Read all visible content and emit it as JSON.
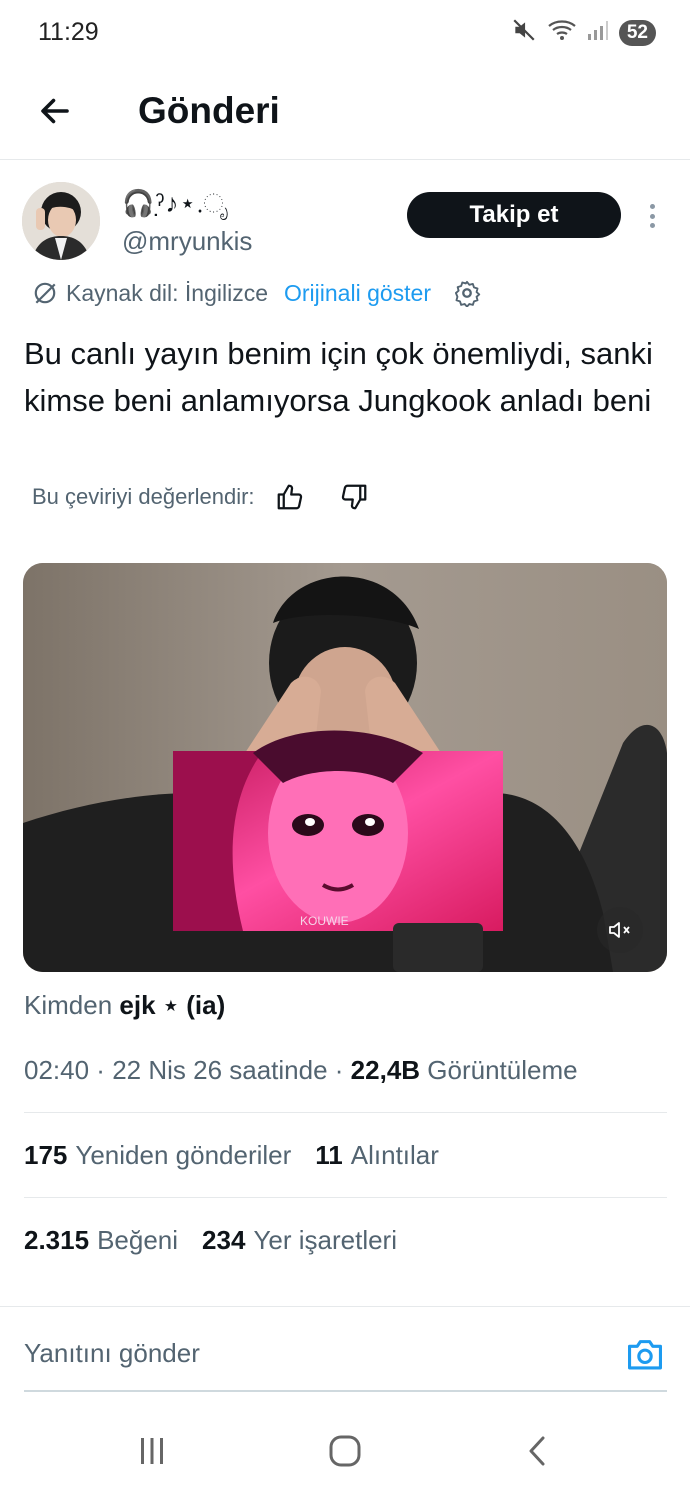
{
  "status_bar": {
    "time": "11:29",
    "battery": "52"
  },
  "header": {
    "title": "Gönderi"
  },
  "author": {
    "display_name": "🎧ˀ̣͏♪⋆.ೃ",
    "handle": "@mryunkis"
  },
  "follow_label": "Takip et",
  "translation": {
    "source_label": "Kaynak dil: İngilizce",
    "show_original": "Orijinali göster"
  },
  "tweet_text": "Bu canlı yayın benim için çok önemliydi, sanki kimse beni anlamıyorsa Jungkook anladı beni",
  "rate_label": "Bu çeviriyi değerlendir:",
  "media": {
    "caption_overlay": "KOUWIE"
  },
  "source": {
    "prefix": "Kimden",
    "name": "ejk ⋆ (ia)"
  },
  "meta": {
    "time": "02:40",
    "sep1": " · ",
    "date": "22 Nis 26 saatinde",
    "sep2": " · ",
    "views_count": "22,4B",
    "views_label": "Görüntüleme"
  },
  "stats": {
    "reposts_count": "175",
    "reposts_label": "Yeniden gönderiler",
    "quotes_count": "11",
    "quotes_label": "Alıntılar",
    "likes_count": "2.315",
    "likes_label": "Beğeni",
    "bookmarks_count": "234",
    "bookmarks_label": "Yer işaretleri"
  },
  "reply": {
    "placeholder": "Yanıtını gönder"
  },
  "colors": {
    "accent": "#1d9bf0",
    "text": "#0f1419",
    "secondary": "#536471"
  },
  "icons": [
    "mute-icon",
    "wifi-icon",
    "signal-icon",
    "back-arrow-icon",
    "more-vertical-icon",
    "translate-icon",
    "gear-icon",
    "thumbs-up-icon",
    "thumbs-down-icon",
    "volume-mute-icon",
    "camera-icon",
    "recents-icon",
    "home-icon",
    "nav-back-icon"
  ]
}
